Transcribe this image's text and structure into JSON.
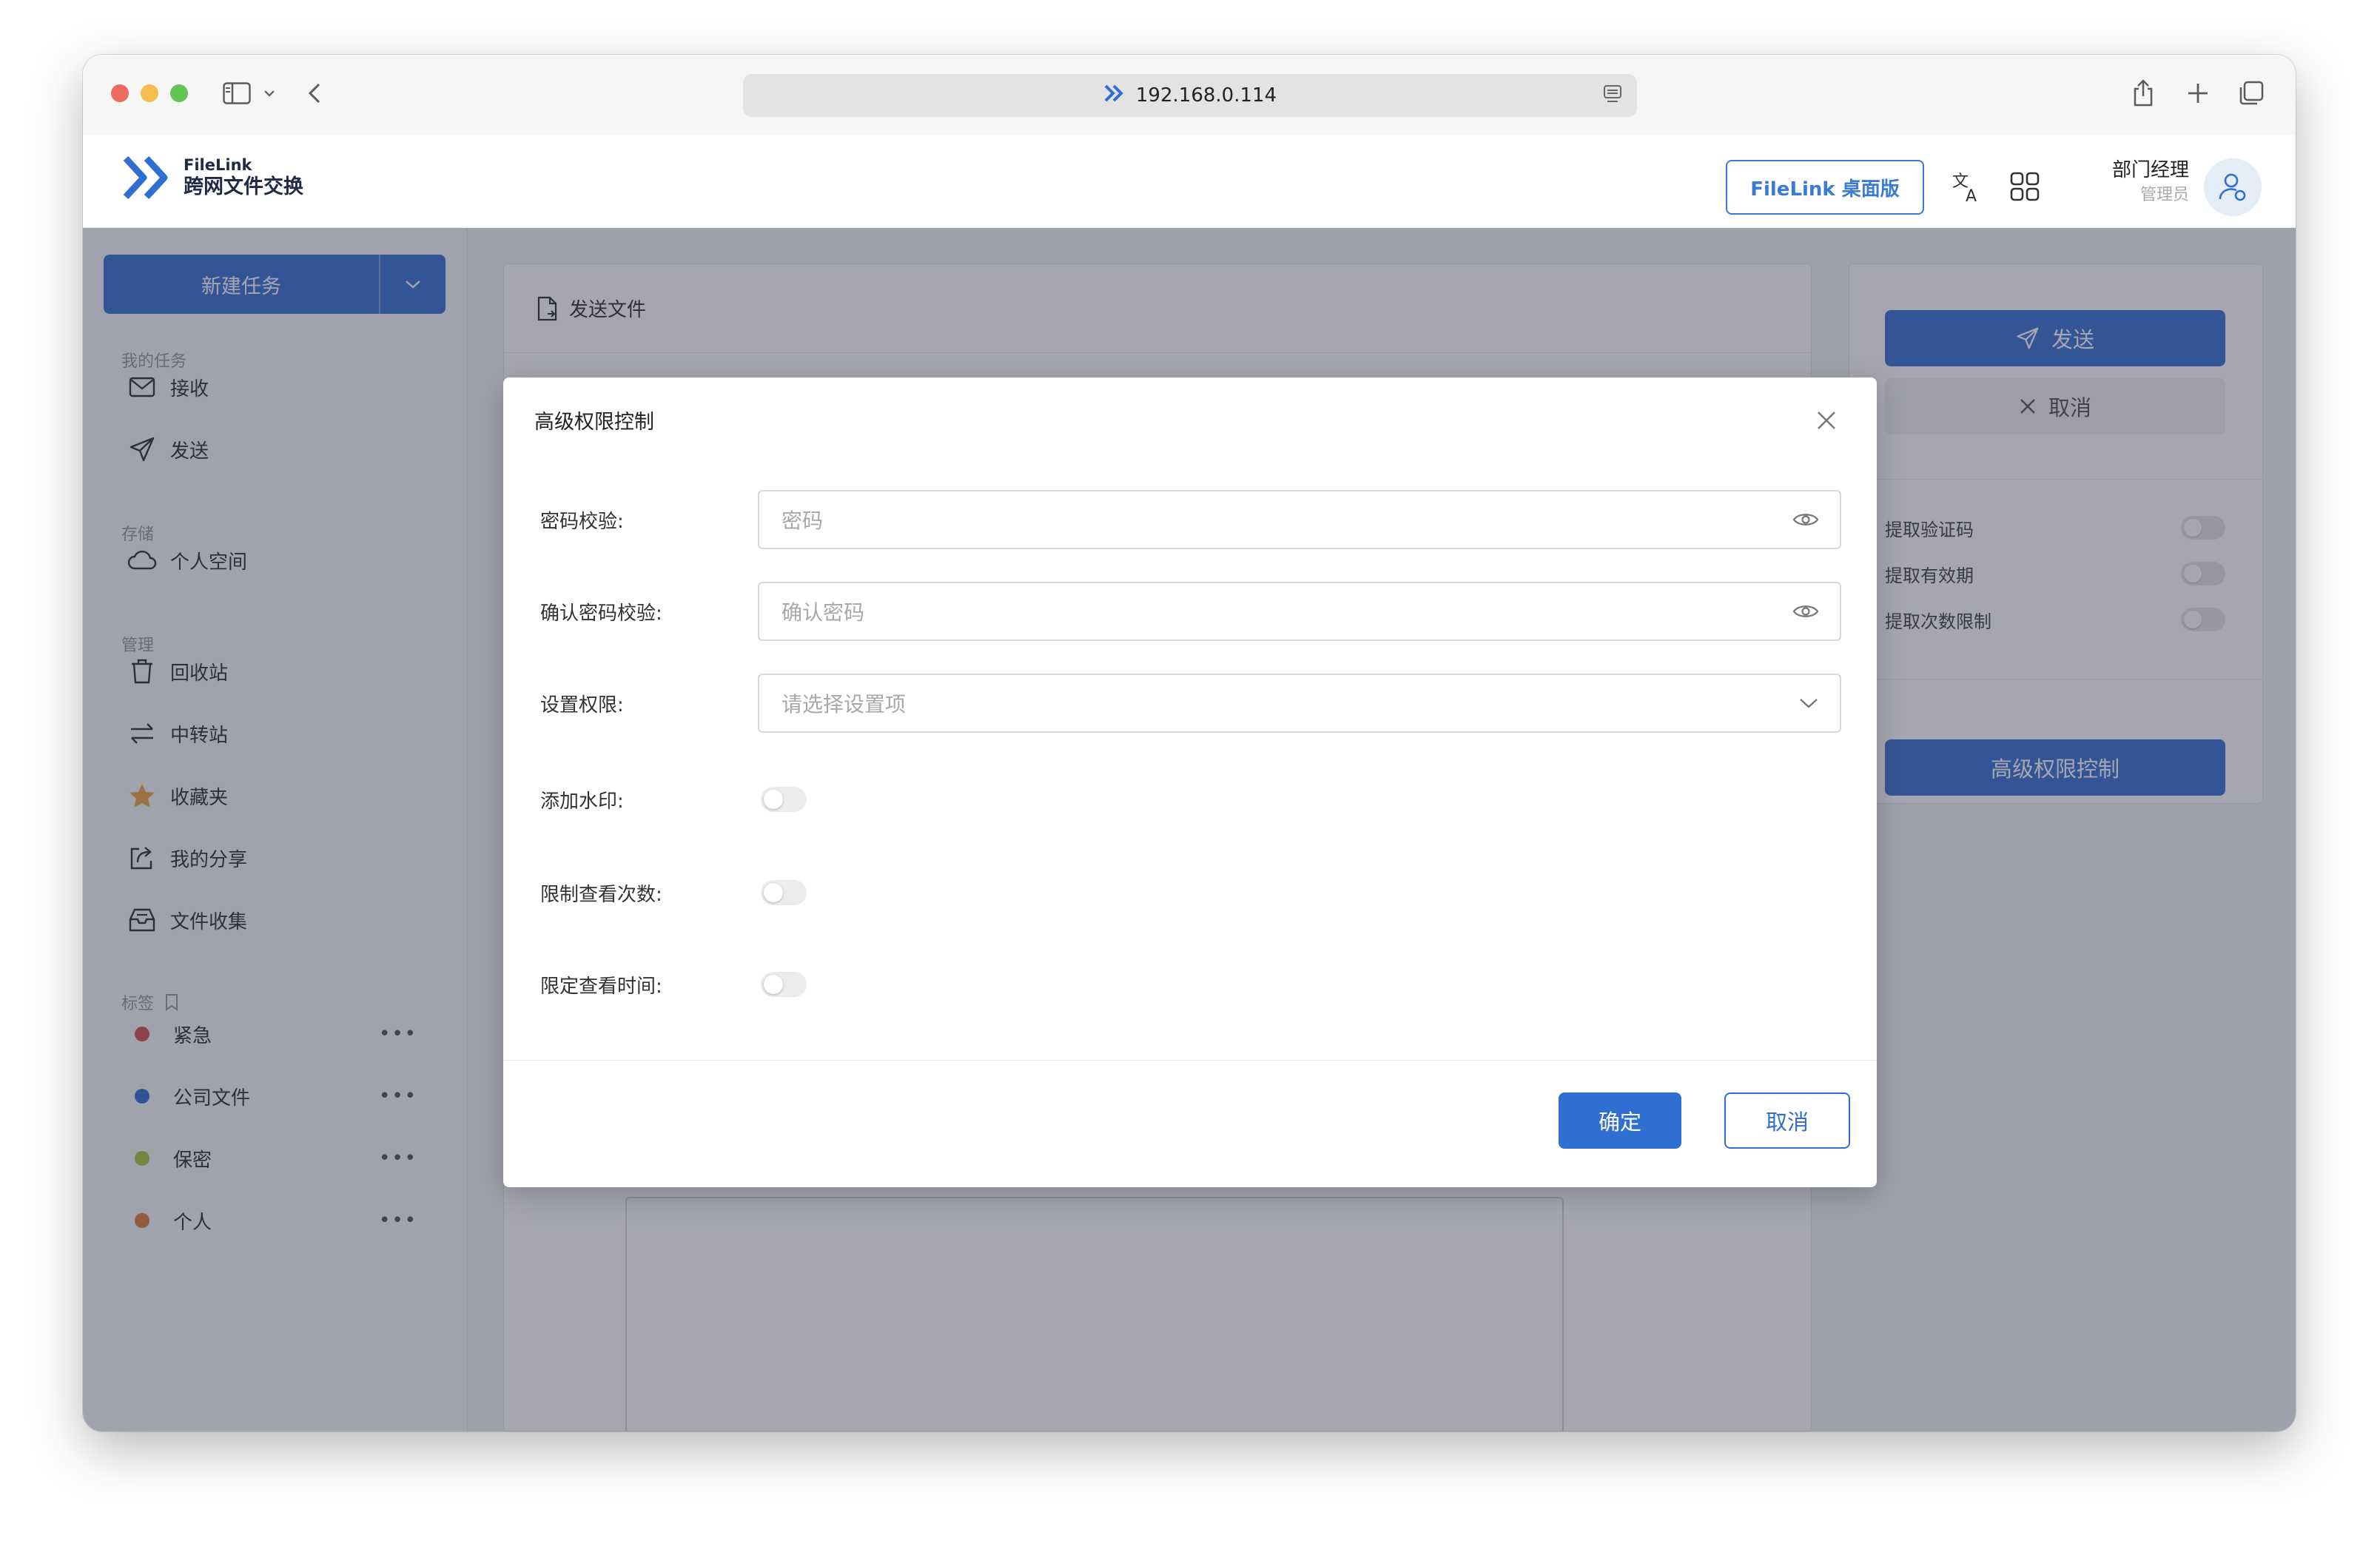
{
  "browser": {
    "url": "192.168.0.114"
  },
  "header": {
    "logo_line1": "FileLink",
    "logo_line2": "跨网文件交换",
    "desktop_button": "FileLink 桌面版",
    "user_name": "部门经理",
    "user_role": "管理员"
  },
  "sidebar": {
    "new_task": "新建任务",
    "sections": {
      "my_tasks": "我的任务",
      "storage": "存储",
      "manage": "管理",
      "tags": "标签"
    },
    "items": {
      "receive": "接收",
      "send": "发送",
      "personal_space": "个人空间",
      "recycle": "回收站",
      "transfer": "中转站",
      "favorites": "收藏夹",
      "my_share": "我的分享",
      "file_collect": "文件收集"
    },
    "tags": [
      {
        "label": "紧急",
        "color": "#d9534f"
      },
      {
        "label": "公司文件",
        "color": "#3a6fd0"
      },
      {
        "label": "保密",
        "color": "#a9c93f"
      },
      {
        "label": "个人",
        "color": "#e07a3c"
      }
    ]
  },
  "main": {
    "header": "发送文件"
  },
  "right_panel": {
    "send": "发送",
    "cancel": "取消",
    "options": [
      "提取验证码",
      "提取有效期",
      "提取次数限制"
    ],
    "advanced": "高级权限控制"
  },
  "modal": {
    "title": "高级权限控制",
    "password_label": "密码校验:",
    "password_placeholder": "密码",
    "confirm_label": "确认密码校验:",
    "confirm_placeholder": "确认密码",
    "permission_label": "设置权限:",
    "permission_placeholder": "请选择设置项",
    "watermark_label": "添加水印:",
    "view_count_label": "限制查看次数:",
    "view_time_label": "限定查看时间:",
    "ok": "确定",
    "cancel": "取消"
  },
  "colors": {
    "primary": "#2f6fd1",
    "overlay": "rgba(40,44,70,0.42)"
  }
}
